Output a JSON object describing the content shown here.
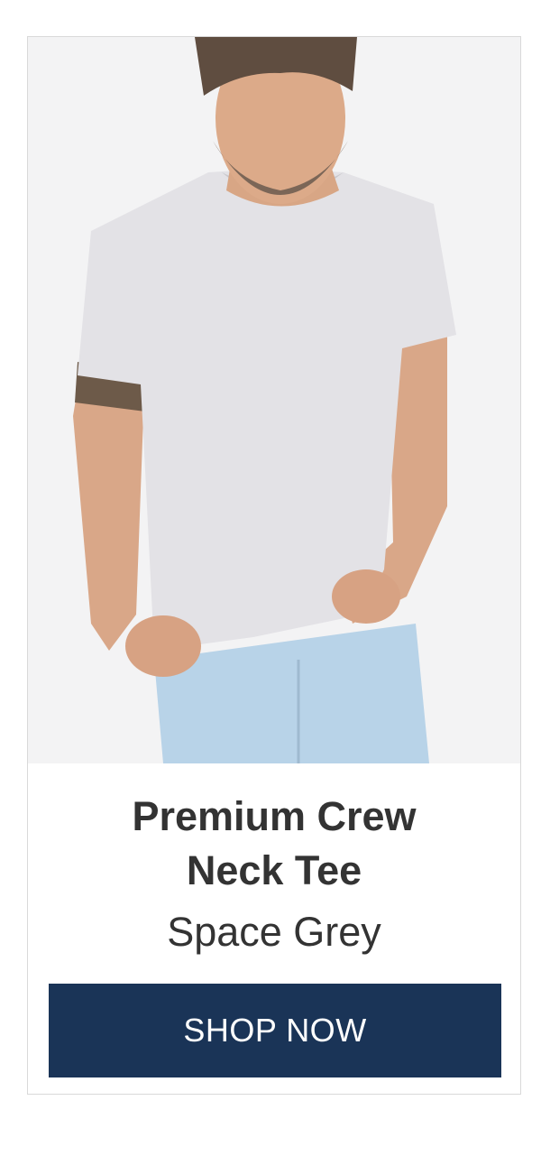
{
  "product": {
    "title_line1": "Premium Crew",
    "title_line2": "Neck Tee",
    "color_name": "Space Grey"
  },
  "cta": {
    "label": "SHOP NOW",
    "color": "#1a3457"
  },
  "image": {
    "shirt_color": "#e3e2e6",
    "jeans_color": "#b8d3e8"
  }
}
